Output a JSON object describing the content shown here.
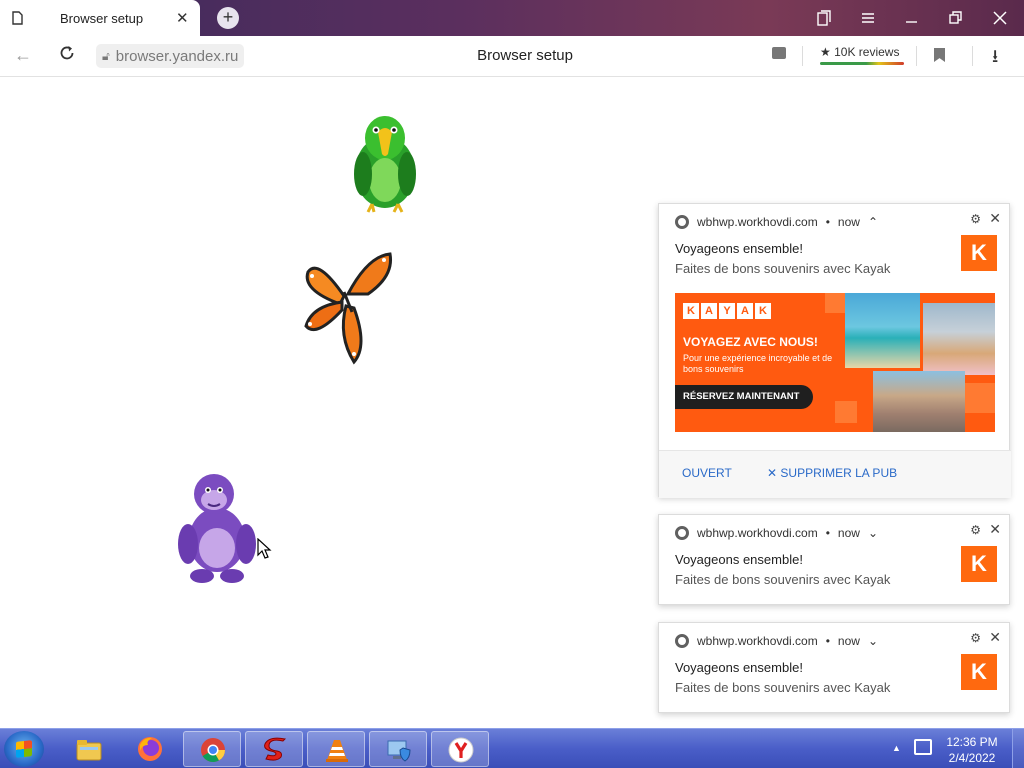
{
  "browser": {
    "tab_title": "Browser setup",
    "tab_close": "✕",
    "new_tab": "+",
    "url": "browser.yandex.ru",
    "page_title": "Browser setup",
    "reviews": "10K reviews",
    "window_controls": [
      "collections-icon",
      "menu-icon",
      "minimize-icon",
      "restore-icon",
      "close-icon"
    ]
  },
  "notifications": [
    {
      "site": "wbhwp.workhovdi.com",
      "time": "now",
      "chevron": "⌃",
      "title": "Voyageons ensemble!",
      "body": "Faites de bons souvenirs avec Kayak",
      "logo": "K",
      "image": {
        "brand_letters": [
          "K",
          "A",
          "Y",
          "A",
          "K"
        ],
        "headline": "VOYAGEZ AVEC NOUS!",
        "subline": "Pour une expérience incroyable et de bons souvenirs",
        "cta": "RÉSERVEZ MAINTENANT"
      },
      "actions": {
        "open": "OUVERT",
        "remove": "SUPPRIMER LA PUB"
      }
    },
    {
      "site": "wbhwp.workhovdi.com",
      "time": "now",
      "chevron": "⌄",
      "title": "Voyageons ensemble!",
      "body": "Faites de bons souvenirs avec Kayak",
      "logo": "K"
    },
    {
      "site": "wbhwp.workhovdi.com",
      "time": "now",
      "chevron": "⌄",
      "title": "Voyageons ensemble!",
      "body": "Faites de bons souvenirs avec Kayak",
      "logo": "K"
    }
  ],
  "taskbar": {
    "apps": [
      "windows-explorer",
      "firefox",
      "chrome",
      "s-app",
      "vlc",
      "security-center",
      "yandex-browser"
    ],
    "time": "12:36 PM",
    "date": "2/4/2022"
  }
}
